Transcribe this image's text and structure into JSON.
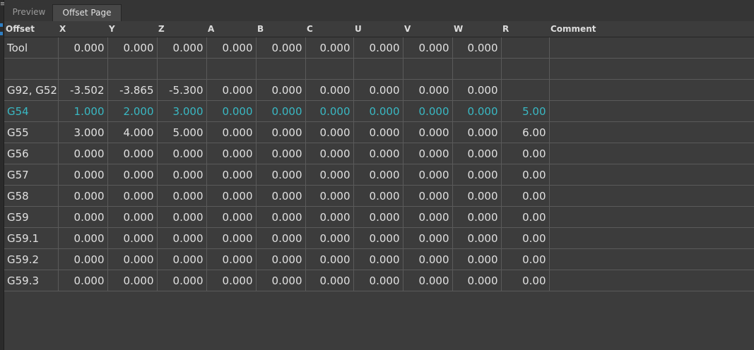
{
  "tabs": [
    {
      "label": "Preview",
      "active": false
    },
    {
      "label": "Offset Page",
      "active": true
    }
  ],
  "table": {
    "columns": [
      "Offset",
      "X",
      "Y",
      "Z",
      "A",
      "B",
      "C",
      "U",
      "V",
      "W",
      "R",
      "Comment"
    ],
    "highlight_color": "#39b8c3",
    "rows": [
      {
        "offset": "Tool",
        "values": [
          "0.000",
          "0.000",
          "0.000",
          "0.000",
          "0.000",
          "0.000",
          "0.000",
          "0.000",
          "0.000"
        ],
        "r": "",
        "comment": ""
      },
      {
        "offset": "",
        "values": [
          "",
          "",
          "",
          "",
          "",
          "",
          "",
          "",
          ""
        ],
        "r": "",
        "comment": ""
      },
      {
        "offset": "G92, G52",
        "values": [
          "-3.502",
          "-3.865",
          "-5.300",
          "0.000",
          "0.000",
          "0.000",
          "0.000",
          "0.000",
          "0.000"
        ],
        "r": "",
        "comment": ""
      },
      {
        "offset": "G54",
        "highlighted": true,
        "values": [
          "1.000",
          "2.000",
          "3.000",
          "0.000",
          "0.000",
          "0.000",
          "0.000",
          "0.000",
          "0.000"
        ],
        "r": "5.00",
        "comment": ""
      },
      {
        "offset": "G55",
        "values": [
          "3.000",
          "4.000",
          "5.000",
          "0.000",
          "0.000",
          "0.000",
          "0.000",
          "0.000",
          "0.000"
        ],
        "r": "6.00",
        "comment": ""
      },
      {
        "offset": "G56",
        "values": [
          "0.000",
          "0.000",
          "0.000",
          "0.000",
          "0.000",
          "0.000",
          "0.000",
          "0.000",
          "0.000"
        ],
        "r": "0.00",
        "comment": ""
      },
      {
        "offset": "G57",
        "values": [
          "0.000",
          "0.000",
          "0.000",
          "0.000",
          "0.000",
          "0.000",
          "0.000",
          "0.000",
          "0.000"
        ],
        "r": "0.00",
        "comment": ""
      },
      {
        "offset": "G58",
        "values": [
          "0.000",
          "0.000",
          "0.000",
          "0.000",
          "0.000",
          "0.000",
          "0.000",
          "0.000",
          "0.000"
        ],
        "r": "0.00",
        "comment": ""
      },
      {
        "offset": "G59",
        "values": [
          "0.000",
          "0.000",
          "0.000",
          "0.000",
          "0.000",
          "0.000",
          "0.000",
          "0.000",
          "0.000"
        ],
        "r": "0.00",
        "comment": ""
      },
      {
        "offset": "G59.1",
        "values": [
          "0.000",
          "0.000",
          "0.000",
          "0.000",
          "0.000",
          "0.000",
          "0.000",
          "0.000",
          "0.000"
        ],
        "r": "0.00",
        "comment": ""
      },
      {
        "offset": "G59.2",
        "values": [
          "0.000",
          "0.000",
          "0.000",
          "0.000",
          "0.000",
          "0.000",
          "0.000",
          "0.000",
          "0.000"
        ],
        "r": "0.00",
        "comment": ""
      },
      {
        "offset": "G59.3",
        "values": [
          "0.000",
          "0.000",
          "0.000",
          "0.000",
          "0.000",
          "0.000",
          "0.000",
          "0.000",
          "0.000"
        ],
        "r": "0.00",
        "comment": ""
      }
    ]
  }
}
